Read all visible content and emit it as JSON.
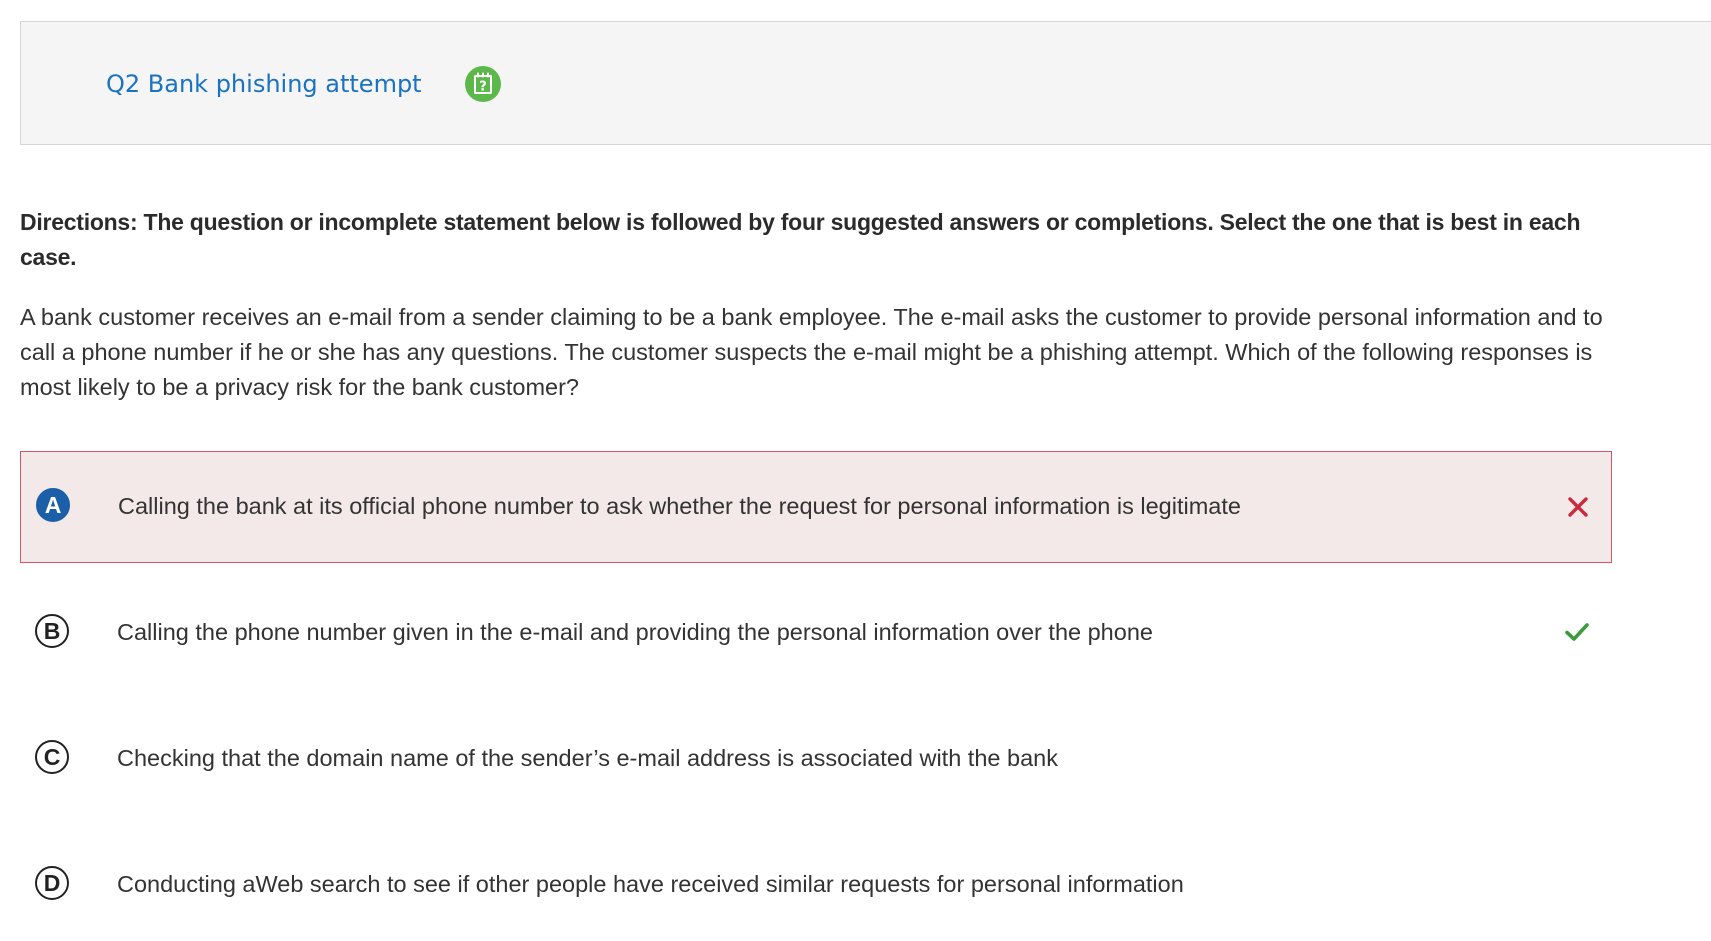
{
  "question": {
    "title": "Q2 Bank phishing attempt",
    "help_icon": "help-notepad-icon"
  },
  "directions": "Directions: The question or incomplete statement below is followed by four suggested answers or completions. Select the one that is best in each case.",
  "stem": "A bank customer receives an e-mail from a sender claiming to be a bank employee. The e-mail asks the customer to provide personal information and to call a phone number if he or she has any questions. The customer suspects the e-mail might be a phishing attempt. Which of the following responses is most likely to be a privacy risk for the bank customer?",
  "options": [
    {
      "letter": "A",
      "text": "Calling the bank at its official phone number to ask whether the request for personal information is legitimate",
      "selected": true,
      "result": "incorrect"
    },
    {
      "letter": "B",
      "text": "Calling the phone number given in the e-mail and providing the personal information over the phone",
      "selected": false,
      "result": "correct"
    },
    {
      "letter": "C",
      "text": "Checking that the domain name of the sender’s e-mail address is associated with the bank",
      "selected": false,
      "result": null
    },
    {
      "letter": "D",
      "text": "Conducting aWeb search to see if other people have received similar requests for personal information",
      "selected": false,
      "result": null
    }
  ],
  "colors": {
    "title": "#1a73c2",
    "help_icon": "#5db84c",
    "selected_bg": "#f3e9e9",
    "selected_border": "#d9536a",
    "selected_letter_bg": "#1b5fa8",
    "incorrect": "#cc2b3b",
    "correct": "#3c9a3c"
  }
}
